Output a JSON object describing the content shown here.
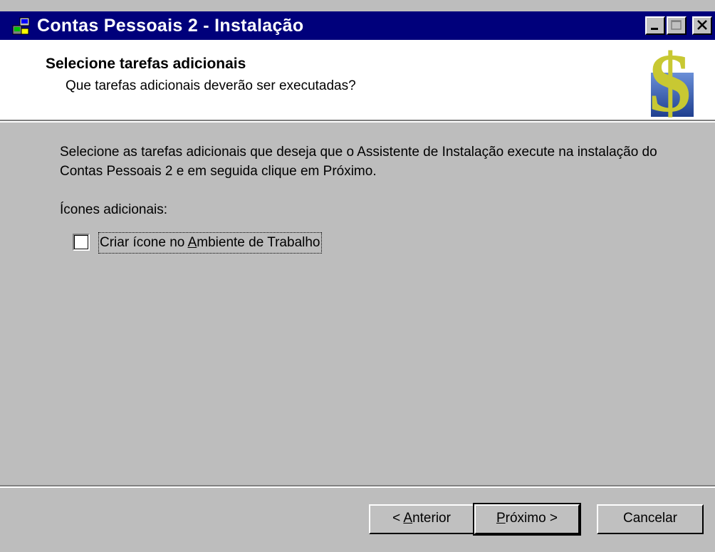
{
  "window": {
    "title": "Contas Pessoais 2 - Instalação"
  },
  "header": {
    "title": "Selecione tarefas adicionais",
    "subtitle": "Que tarefas adicionais deverão ser executadas?"
  },
  "main": {
    "description": "Selecione as tarefas adicionais que deseja que o Assistente de Instalação execute na instalação do Contas Pessoais 2 e em seguida clique em Próximo.",
    "icons_label": "Ícones adicionais:",
    "checkbox": {
      "label_before": "Criar ícone no ",
      "label_hotkey": "A",
      "label_after": "mbiente de Trabalho",
      "checked": false
    }
  },
  "buttons": {
    "back_prefix": "< ",
    "back_hotkey": "A",
    "back_rest": "nterior",
    "next_hotkey": "P",
    "next_rest": "róximo >",
    "cancel": "Cancelar"
  },
  "colors": {
    "titlebar": "#00007b",
    "face": "#c0c0c0",
    "logo_dollar": "#c8c832",
    "logo_bg": "#3a5fae"
  }
}
